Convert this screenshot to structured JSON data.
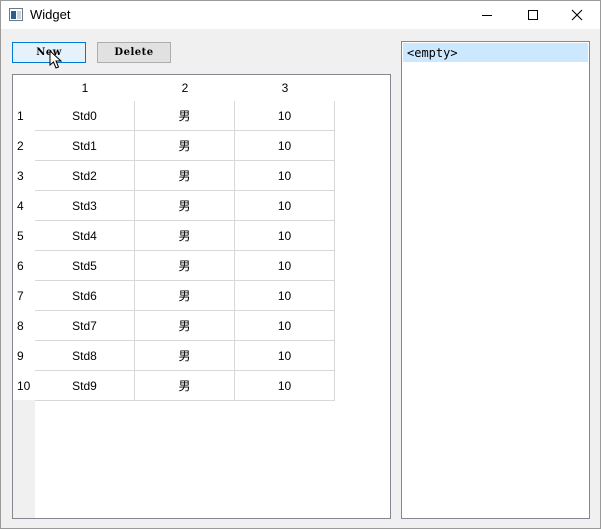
{
  "window": {
    "title": "Widget",
    "icons": {
      "app": "app-window-icon",
      "minimize": "minimize-icon",
      "maximize": "maximize-icon",
      "close": "close-icon"
    }
  },
  "toolbar": {
    "new_label": "New",
    "delete_label": "Delete"
  },
  "table": {
    "columns": [
      "1",
      "2",
      "3"
    ],
    "row_headers": [
      "1",
      "2",
      "3",
      "4",
      "5",
      "6",
      "7",
      "8",
      "9",
      "10"
    ],
    "rows": [
      [
        "Std0",
        "男",
        "10"
      ],
      [
        "Std1",
        "男",
        "10"
      ],
      [
        "Std2",
        "男",
        "10"
      ],
      [
        "Std3",
        "男",
        "10"
      ],
      [
        "Std4",
        "男",
        "10"
      ],
      [
        "Std5",
        "男",
        "10"
      ],
      [
        "Std6",
        "男",
        "10"
      ],
      [
        "Std7",
        "男",
        "10"
      ],
      [
        "Std8",
        "男",
        "10"
      ],
      [
        "Std9",
        "男",
        "10"
      ]
    ]
  },
  "list": {
    "items": [
      "<empty>"
    ]
  },
  "colors": {
    "selection": "#cce8ff",
    "focus_border": "#0078d7"
  }
}
